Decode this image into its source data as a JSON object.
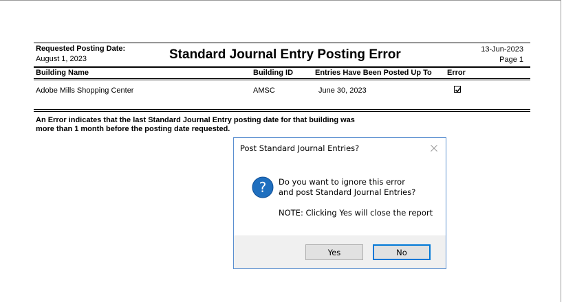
{
  "report": {
    "requested_posting_date_label": "Requested Posting Date:",
    "requested_posting_date": "August 1, 2023",
    "title": "Standard Journal Entry Posting Error",
    "run_date": "13-Jun-2023",
    "page": "Page 1",
    "columns": {
      "building_name": "Building Name",
      "building_id": "Building ID",
      "posted_up_to": "Entries Have Been Posted Up To",
      "error": "Error"
    },
    "rows": [
      {
        "building_name": "Adobe Mills Shopping Center",
        "building_id": "AMSC",
        "posted_up_to": "June 30, 2023",
        "error": true
      }
    ],
    "footnote_line1": "An Error indicates that the last Standard Journal Entry posting date for that building was",
    "footnote_line2": "more than 1 month before the posting date requested."
  },
  "dialog": {
    "title": "Post Standard Journal Entries?",
    "close_icon": "close-icon",
    "question_icon": "question-icon",
    "message_line1": "Do you want to ignore this error",
    "message_line2": "and post Standard Journal Entries?",
    "note": "NOTE: Clicking Yes will close the report",
    "yes_label": "Yes",
    "no_label": "No",
    "accent_color": "#0078d7",
    "icon_color": "#1f6fbf"
  }
}
